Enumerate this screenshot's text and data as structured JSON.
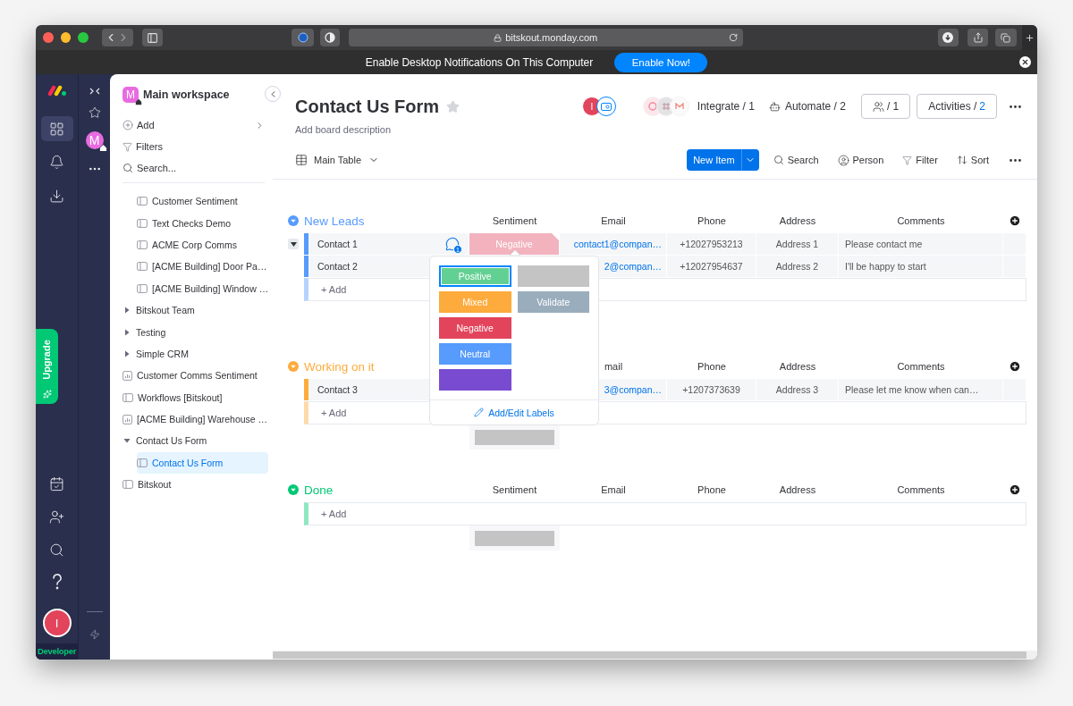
{
  "browser": {
    "url": "bitskout.monday.com"
  },
  "notification": {
    "text": "Enable Desktop Notifications On This Computer",
    "button": "Enable Now!"
  },
  "rail": {
    "upgrade": "Upgrade",
    "avatar": "I",
    "account_label": "Developer"
  },
  "workspace_rail": {
    "avatar": "M"
  },
  "sidebar": {
    "workspace": {
      "avatar": "M",
      "name": "Main workspace"
    },
    "actions": [
      {
        "label": "Add",
        "kind": "add"
      },
      {
        "label": "Filters",
        "kind": "filter"
      },
      {
        "label": "Search...",
        "kind": "search"
      }
    ],
    "tree": [
      {
        "children": [
          {
            "label": "Customer Sentiment",
            "kind": "board",
            "selected": false
          },
          {
            "label": "Text Checks Demo",
            "kind": "board",
            "selected": false
          },
          {
            "label": "ACME Corp Comms",
            "kind": "board",
            "selected": false
          },
          {
            "label": "[ACME Building] Door Pa…",
            "kind": "board",
            "selected": false
          },
          {
            "label": "[ACME Building] Window …",
            "kind": "board",
            "selected": false
          }
        ]
      },
      {
        "label": "Bitskout Team",
        "kind": "folder",
        "expanded": false
      },
      {
        "label": "Testing",
        "kind": "folder",
        "expanded": false
      },
      {
        "label": "Simple CRM",
        "kind": "folder",
        "expanded": false
      },
      {
        "label": "Customer Comms Sentiment",
        "kind": "dashboard",
        "selected": false
      },
      {
        "label": "Workflows [Bitskout]",
        "kind": "board",
        "selected": false
      },
      {
        "label": "[ACME Building] Warehouse …",
        "kind": "dashboard",
        "selected": false
      },
      {
        "label": "Contact Us Form",
        "kind": "folder",
        "expanded": true,
        "children": [
          {
            "label": "Contact Us Form",
            "kind": "board",
            "selected": true
          }
        ]
      },
      {
        "label": "Bitskout",
        "kind": "board",
        "selected": false
      }
    ]
  },
  "board": {
    "title": "Contact Us Form",
    "description": "Add board description",
    "avatar": "I",
    "integrate": "Integrate / 1",
    "automate": "Automate / 2",
    "members": "/ 1",
    "activities": {
      "label": "Activities /",
      "count": "2"
    }
  },
  "toolbar": {
    "view": "Main Table",
    "new_item": "New Item",
    "actions": [
      {
        "label": "Search",
        "kind": "search"
      },
      {
        "label": "Person",
        "kind": "person"
      },
      {
        "label": "Filter",
        "kind": "filter"
      },
      {
        "label": "Sort",
        "kind": "sort"
      }
    ]
  },
  "groups": [
    {
      "title": "New Leads",
      "color": "#579bfc",
      "add": "+ Add",
      "columns": {
        "sentiment": "Sentiment",
        "email": "Email",
        "phone": "Phone",
        "address": "Address",
        "comments": "Comments"
      },
      "rows": [
        {
          "name": "Contact 1",
          "hovered": true,
          "updates": "1",
          "sentiment": {
            "label": "Negative",
            "color": "#f2b3be"
          },
          "email": "contact1@compan…",
          "phone": "+12027953213",
          "address": "Address 1",
          "comments": "Please contact me",
          "picker": {
            "columns": [
              {
                "labels": [
                  {
                    "label": "Positive",
                    "color": "#63d093",
                    "selected": true
                  },
                  {
                    "label": "Mixed",
                    "color": "#fdab3d",
                    "selected": false
                  },
                  {
                    "label": "Negative",
                    "color": "#e2445c",
                    "selected": false
                  },
                  {
                    "label": "Neutral",
                    "color": "#579bfc",
                    "selected": false
                  },
                  {
                    "color": "#784bd1",
                    "selected": false
                  }
                ]
              },
              {
                "labels": [
                  {
                    "color": "#c4c4c4",
                    "selected": false
                  },
                  {
                    "label": "Validate",
                    "color": "#9aadbd",
                    "selected": false
                  }
                ]
              }
            ],
            "footer": "Add/Edit Labels"
          }
        },
        {
          "name": "Contact 2",
          "email": "2@compan…",
          "phone": "+12027954637",
          "address": "Address 2",
          "comments": "I'll be happy to start"
        }
      ]
    },
    {
      "title": "Working on it",
      "color": "#fdab3d",
      "summary_bar": true,
      "add": "+ Add",
      "columns": {
        "email": "mail",
        "phone": "Phone",
        "address": "Address",
        "comments": "Comments"
      },
      "rows": [
        {
          "name": "Contact 3",
          "email": "3@compan…",
          "phone": "+1207373639",
          "address": "Address 3",
          "comments": "Please let me know when can…"
        }
      ]
    },
    {
      "title": "Done",
      "color": "#00c875",
      "summary_bar": true,
      "add": "+ Add",
      "columns": {
        "sentiment": "Sentiment",
        "email": "Email",
        "phone": "Phone",
        "address": "Address",
        "comments": "Comments"
      }
    }
  ]
}
